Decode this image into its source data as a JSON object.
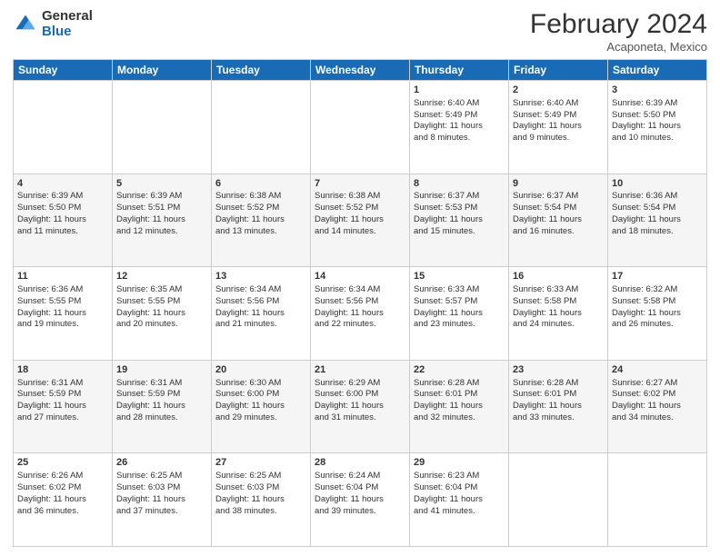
{
  "header": {
    "logo_general": "General",
    "logo_blue": "Blue",
    "month_title": "February 2024",
    "subtitle": "Acaponeta, Mexico"
  },
  "days_of_week": [
    "Sunday",
    "Monday",
    "Tuesday",
    "Wednesday",
    "Thursday",
    "Friday",
    "Saturday"
  ],
  "weeks": [
    {
      "bg": "white",
      "days": [
        {
          "num": "",
          "lines": []
        },
        {
          "num": "",
          "lines": []
        },
        {
          "num": "",
          "lines": []
        },
        {
          "num": "",
          "lines": []
        },
        {
          "num": "1",
          "lines": [
            "Sunrise: 6:40 AM",
            "Sunset: 5:49 PM",
            "Daylight: 11 hours",
            "and 8 minutes."
          ]
        },
        {
          "num": "2",
          "lines": [
            "Sunrise: 6:40 AM",
            "Sunset: 5:49 PM",
            "Daylight: 11 hours",
            "and 9 minutes."
          ]
        },
        {
          "num": "3",
          "lines": [
            "Sunrise: 6:39 AM",
            "Sunset: 5:50 PM",
            "Daylight: 11 hours",
            "and 10 minutes."
          ]
        }
      ]
    },
    {
      "bg": "alt",
      "days": [
        {
          "num": "4",
          "lines": [
            "Sunrise: 6:39 AM",
            "Sunset: 5:50 PM",
            "Daylight: 11 hours",
            "and 11 minutes."
          ]
        },
        {
          "num": "5",
          "lines": [
            "Sunrise: 6:39 AM",
            "Sunset: 5:51 PM",
            "Daylight: 11 hours",
            "and 12 minutes."
          ]
        },
        {
          "num": "6",
          "lines": [
            "Sunrise: 6:38 AM",
            "Sunset: 5:52 PM",
            "Daylight: 11 hours",
            "and 13 minutes."
          ]
        },
        {
          "num": "7",
          "lines": [
            "Sunrise: 6:38 AM",
            "Sunset: 5:52 PM",
            "Daylight: 11 hours",
            "and 14 minutes."
          ]
        },
        {
          "num": "8",
          "lines": [
            "Sunrise: 6:37 AM",
            "Sunset: 5:53 PM",
            "Daylight: 11 hours",
            "and 15 minutes."
          ]
        },
        {
          "num": "9",
          "lines": [
            "Sunrise: 6:37 AM",
            "Sunset: 5:54 PM",
            "Daylight: 11 hours",
            "and 16 minutes."
          ]
        },
        {
          "num": "10",
          "lines": [
            "Sunrise: 6:36 AM",
            "Sunset: 5:54 PM",
            "Daylight: 11 hours",
            "and 18 minutes."
          ]
        }
      ]
    },
    {
      "bg": "white",
      "days": [
        {
          "num": "11",
          "lines": [
            "Sunrise: 6:36 AM",
            "Sunset: 5:55 PM",
            "Daylight: 11 hours",
            "and 19 minutes."
          ]
        },
        {
          "num": "12",
          "lines": [
            "Sunrise: 6:35 AM",
            "Sunset: 5:55 PM",
            "Daylight: 11 hours",
            "and 20 minutes."
          ]
        },
        {
          "num": "13",
          "lines": [
            "Sunrise: 6:34 AM",
            "Sunset: 5:56 PM",
            "Daylight: 11 hours",
            "and 21 minutes."
          ]
        },
        {
          "num": "14",
          "lines": [
            "Sunrise: 6:34 AM",
            "Sunset: 5:56 PM",
            "Daylight: 11 hours",
            "and 22 minutes."
          ]
        },
        {
          "num": "15",
          "lines": [
            "Sunrise: 6:33 AM",
            "Sunset: 5:57 PM",
            "Daylight: 11 hours",
            "and 23 minutes."
          ]
        },
        {
          "num": "16",
          "lines": [
            "Sunrise: 6:33 AM",
            "Sunset: 5:58 PM",
            "Daylight: 11 hours",
            "and 24 minutes."
          ]
        },
        {
          "num": "17",
          "lines": [
            "Sunrise: 6:32 AM",
            "Sunset: 5:58 PM",
            "Daylight: 11 hours",
            "and 26 minutes."
          ]
        }
      ]
    },
    {
      "bg": "alt",
      "days": [
        {
          "num": "18",
          "lines": [
            "Sunrise: 6:31 AM",
            "Sunset: 5:59 PM",
            "Daylight: 11 hours",
            "and 27 minutes."
          ]
        },
        {
          "num": "19",
          "lines": [
            "Sunrise: 6:31 AM",
            "Sunset: 5:59 PM",
            "Daylight: 11 hours",
            "and 28 minutes."
          ]
        },
        {
          "num": "20",
          "lines": [
            "Sunrise: 6:30 AM",
            "Sunset: 6:00 PM",
            "Daylight: 11 hours",
            "and 29 minutes."
          ]
        },
        {
          "num": "21",
          "lines": [
            "Sunrise: 6:29 AM",
            "Sunset: 6:00 PM",
            "Daylight: 11 hours",
            "and 31 minutes."
          ]
        },
        {
          "num": "22",
          "lines": [
            "Sunrise: 6:28 AM",
            "Sunset: 6:01 PM",
            "Daylight: 11 hours",
            "and 32 minutes."
          ]
        },
        {
          "num": "23",
          "lines": [
            "Sunrise: 6:28 AM",
            "Sunset: 6:01 PM",
            "Daylight: 11 hours",
            "and 33 minutes."
          ]
        },
        {
          "num": "24",
          "lines": [
            "Sunrise: 6:27 AM",
            "Sunset: 6:02 PM",
            "Daylight: 11 hours",
            "and 34 minutes."
          ]
        }
      ]
    },
    {
      "bg": "white",
      "days": [
        {
          "num": "25",
          "lines": [
            "Sunrise: 6:26 AM",
            "Sunset: 6:02 PM",
            "Daylight: 11 hours",
            "and 36 minutes."
          ]
        },
        {
          "num": "26",
          "lines": [
            "Sunrise: 6:25 AM",
            "Sunset: 6:03 PM",
            "Daylight: 11 hours",
            "and 37 minutes."
          ]
        },
        {
          "num": "27",
          "lines": [
            "Sunrise: 6:25 AM",
            "Sunset: 6:03 PM",
            "Daylight: 11 hours",
            "and 38 minutes."
          ]
        },
        {
          "num": "28",
          "lines": [
            "Sunrise: 6:24 AM",
            "Sunset: 6:04 PM",
            "Daylight: 11 hours",
            "and 39 minutes."
          ]
        },
        {
          "num": "29",
          "lines": [
            "Sunrise: 6:23 AM",
            "Sunset: 6:04 PM",
            "Daylight: 11 hours",
            "and 41 minutes."
          ]
        },
        {
          "num": "",
          "lines": []
        },
        {
          "num": "",
          "lines": []
        }
      ]
    }
  ]
}
